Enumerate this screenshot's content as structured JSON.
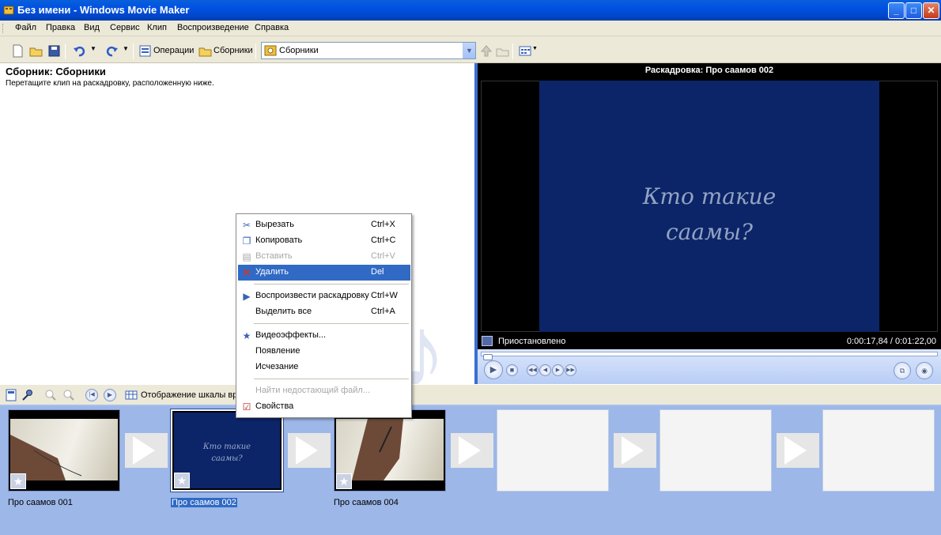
{
  "window": {
    "title": "Без имени - Windows Movie Maker",
    "minimize": "_",
    "maximize": "□",
    "close": "✕"
  },
  "menu": [
    "Файл",
    "Правка",
    "Вид",
    "Сервис",
    "Клип",
    "Воспроизведение",
    "Справка"
  ],
  "toolbar": {
    "operations_label": "Операции",
    "collections_label": "Сборники",
    "collection_combo_value": "Сборники"
  },
  "collection_pane": {
    "heading": "Сборник: Сборники",
    "instruction": "Перетащите клип на раскадровку, расположенную ниже."
  },
  "preview": {
    "title": "Раскадровка: Про саамов 002",
    "screen_line1": "Кто такие",
    "screen_line2": "саамы?",
    "status": "Приостановлено",
    "time": "0:00:17,84 / 0:01:22,00"
  },
  "context_menu": [
    {
      "label": "Вырезать",
      "shortcut": "Ctrl+X",
      "icon": "scissors-icon",
      "enabled": true
    },
    {
      "label": "Копировать",
      "shortcut": "Ctrl+C",
      "icon": "copy-icon",
      "enabled": true
    },
    {
      "label": "Вставить",
      "shortcut": "Ctrl+V",
      "icon": "paste-icon",
      "enabled": false
    },
    {
      "label": "Удалить",
      "shortcut": "Del",
      "icon": "delete-icon",
      "enabled": true,
      "highlighted": true
    },
    {
      "label": "Воспроизвести раскадровку",
      "shortcut": "Ctrl+W",
      "icon": "play-icon",
      "enabled": true
    },
    {
      "label": "Выделить все",
      "shortcut": "Ctrl+A",
      "enabled": true
    },
    {
      "label": "Видеоэффекты...",
      "icon": "effects-star-icon",
      "enabled": true
    },
    {
      "label": "Появление",
      "enabled": true
    },
    {
      "label": "Исчезание",
      "enabled": true
    },
    {
      "label": "Найти недостающий файл...",
      "enabled": false
    },
    {
      "label": "Свойства",
      "icon": "properties-icon",
      "enabled": true
    }
  ],
  "storyboard": {
    "timeline_toggle_label": "Отображение шкалы вре",
    "clips": [
      {
        "label": "Про саамов 001"
      },
      {
        "label": "Про саамов 002",
        "card_line1": "Кто такие",
        "card_line2": "саамы?",
        "selected": true
      },
      {
        "label": "Про саамов 004"
      }
    ]
  },
  "colors": {
    "titlebar": "#0153e3",
    "selection": "#316ac5",
    "storyboard_bg": "#9cb7e8",
    "title_card": "#0c2568"
  }
}
